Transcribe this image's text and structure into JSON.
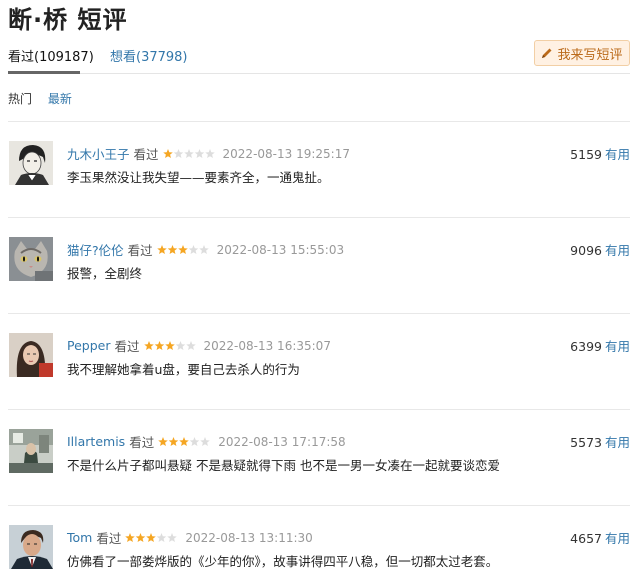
{
  "page_title": "断·桥 短评",
  "tabs": {
    "watched": "看过(109187)",
    "want": "想看(37798)"
  },
  "write_button": "我来写短评",
  "sort": {
    "hot": "热门",
    "latest": "最新"
  },
  "colors": {
    "link": "#3377aa",
    "star": "#f5a623",
    "star_empty": "#dddddd",
    "button_bg": "#fff1e3",
    "button_text": "#bb6a1a"
  },
  "comments": [
    {
      "user": "九木小王子",
      "status": "看过",
      "rating": 1,
      "time": "2022-08-13 19:25:17",
      "text": "李玉果然没让我失望——要素齐全，一通鬼扯。",
      "votes": "5159",
      "useful": "有用",
      "avatar": "portrait-man-sketch"
    },
    {
      "user": "猫仔?伦伦",
      "status": "看过",
      "rating": 3,
      "time": "2022-08-13 15:55:03",
      "text": "报警，全剧终",
      "votes": "9096",
      "useful": "有用",
      "avatar": "cat"
    },
    {
      "user": "Pepper",
      "status": "看过",
      "rating": 3,
      "time": "2022-08-13 16:35:07",
      "text": "我不理解她拿着u盘，要自己去杀人的行为",
      "votes": "6399",
      "useful": "有用",
      "avatar": "woman-portrait"
    },
    {
      "user": "Illartemis",
      "status": "看过",
      "rating": 3,
      "time": "2022-08-13 17:17:58",
      "text": "不是什么片子都叫悬疑 不是悬疑就得下雨 也不是一男一女凑在一起就要谈恋爱",
      "votes": "5573",
      "useful": "有用",
      "avatar": "room-scene"
    },
    {
      "user": "Tom",
      "status": "看过",
      "rating": 3,
      "time": "2022-08-13 13:11:30",
      "text": "仿佛看了一部娄烨版的《少年的你》，故事讲得四平八稳，但一切都太过老套。",
      "votes": "4657",
      "useful": "有用",
      "avatar": "man-suit"
    }
  ]
}
